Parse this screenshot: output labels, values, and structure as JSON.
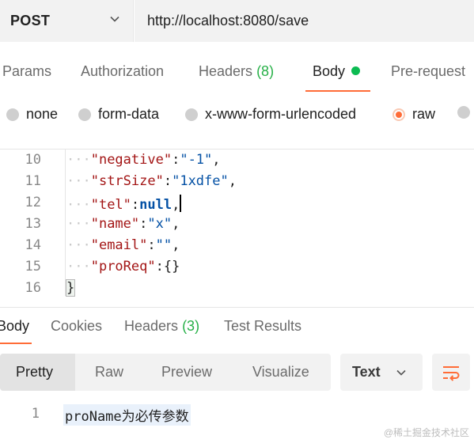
{
  "request": {
    "method": "POST",
    "url": "http://localhost:8080/save"
  },
  "request_tabs": {
    "params": "Params",
    "authorization": "Authorization",
    "headers_label": "Headers",
    "headers_count": "(8)",
    "body": "Body",
    "pre_request": "Pre-request"
  },
  "body_types": {
    "none": "none",
    "form_data": "form-data",
    "urlencoded": "x-www-form-urlencoded",
    "raw": "raw",
    "selected": "raw"
  },
  "editor": {
    "lines": [
      {
        "num": "10",
        "key": "\"negative\"",
        "value": "\"-1\"",
        "trail": ","
      },
      {
        "num": "11",
        "key": "\"strSize\"",
        "value": "\"1xdfe\"",
        "trail": ","
      },
      {
        "num": "12",
        "key": "\"tel\"",
        "value": "null",
        "trail": ","
      },
      {
        "num": "13",
        "key": "\"name\"",
        "value": "\"x\"",
        "trail": ","
      },
      {
        "num": "14",
        "key": "\"email\"",
        "value": "\"\"",
        "trail": ","
      },
      {
        "num": "15",
        "key": "\"proReq\"",
        "value": "{}",
        "trail": ""
      },
      {
        "num": "16",
        "text": "}"
      }
    ]
  },
  "response_tabs": {
    "body": "Body",
    "cookies": "Cookies",
    "headers_label": "Headers",
    "headers_count": "(3)",
    "test_results": "Test Results"
  },
  "response_toolbar": {
    "views": [
      "Pretty",
      "Raw",
      "Preview",
      "Visualize"
    ],
    "active_view": "Pretty",
    "format": "Text"
  },
  "response_body": {
    "line_number": "1",
    "text": "proName为必传参数"
  },
  "watermark": "@稀土掘金技术社区",
  "colors": {
    "accent": "#ff6c37",
    "active_dot": "#0cbb52",
    "count_green": "#26b047"
  },
  "icons": {
    "method_dropdown": "chevron-down-icon",
    "format_dropdown": "chevron-down-icon",
    "wrap": "wrap-lines-icon"
  }
}
